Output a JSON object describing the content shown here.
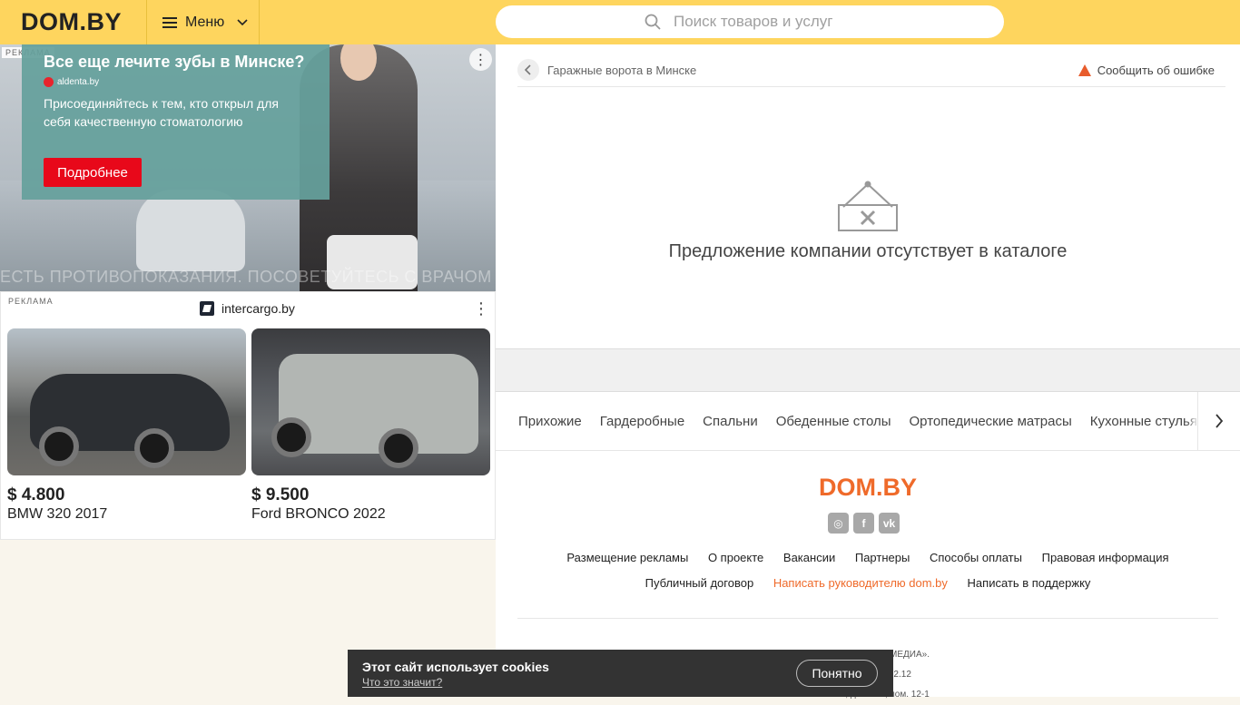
{
  "header": {
    "logo": "DOM.BY",
    "menu_label": "Меню",
    "search_placeholder": "Поиск товаров и услуг"
  },
  "ads": {
    "ad1": {
      "tag": "РЕКЛАМА",
      "title": "Все еще лечите зубы в Минске?",
      "source": "aldenta.by",
      "text": "Присоединяйтесь к тем, кто открыл для себя качественную стоматологию",
      "cta": "Подробнее",
      "warning": "ЕСТЬ ПРОТИВОПОКАЗАНИЯ. ПОСОВЕТУЙТЕСЬ С ВРАЧОМ"
    },
    "ad2": {
      "tag": "РЕКЛАМА",
      "site": "intercargo.by",
      "cars": [
        {
          "price": "$ 4.800",
          "name": "BMW 320 2017"
        },
        {
          "price": "$ 9.500",
          "name": "Ford BRONCO 2022"
        }
      ]
    }
  },
  "breadcrumb": {
    "text": "Гаражные ворота в Минске",
    "report": "Сообщить об ошибке"
  },
  "empty_message": "Предложение компании отсутствует в каталоге",
  "categories": [
    "Прихожие",
    "Гардеробные",
    "Спальни",
    "Обеденные столы",
    "Ортопедические матрасы",
    "Кухонные стулья"
  ],
  "footer": {
    "logo": "DOM.BY",
    "socials": [
      "instagram-icon",
      "facebook-icon",
      "vk-icon"
    ],
    "links_row1": [
      "Размещение рекламы",
      "О проекте",
      "Вакансии",
      "Партнеры",
      "Способы оплаты",
      "Правовая информация"
    ],
    "links_row2": [
      "Публичный договор",
      "Написать руководителю dom.by",
      "Написать в поддержку"
    ],
    "legal": [
      "© 2008-2023 «ДОМ МЕДИА».",
      "…исполком 10.12.12",
      "…альная, дом 11Б, пом. 12-1"
    ]
  },
  "cookie": {
    "title": "Этот сайт использует cookies",
    "link": "Что это значит?",
    "button": "Понятно"
  },
  "colors": {
    "header_bg": "#fed55e",
    "accent": "#ef6a2a",
    "ad_cta": "#e8081a",
    "cookie_bg": "#333333"
  }
}
